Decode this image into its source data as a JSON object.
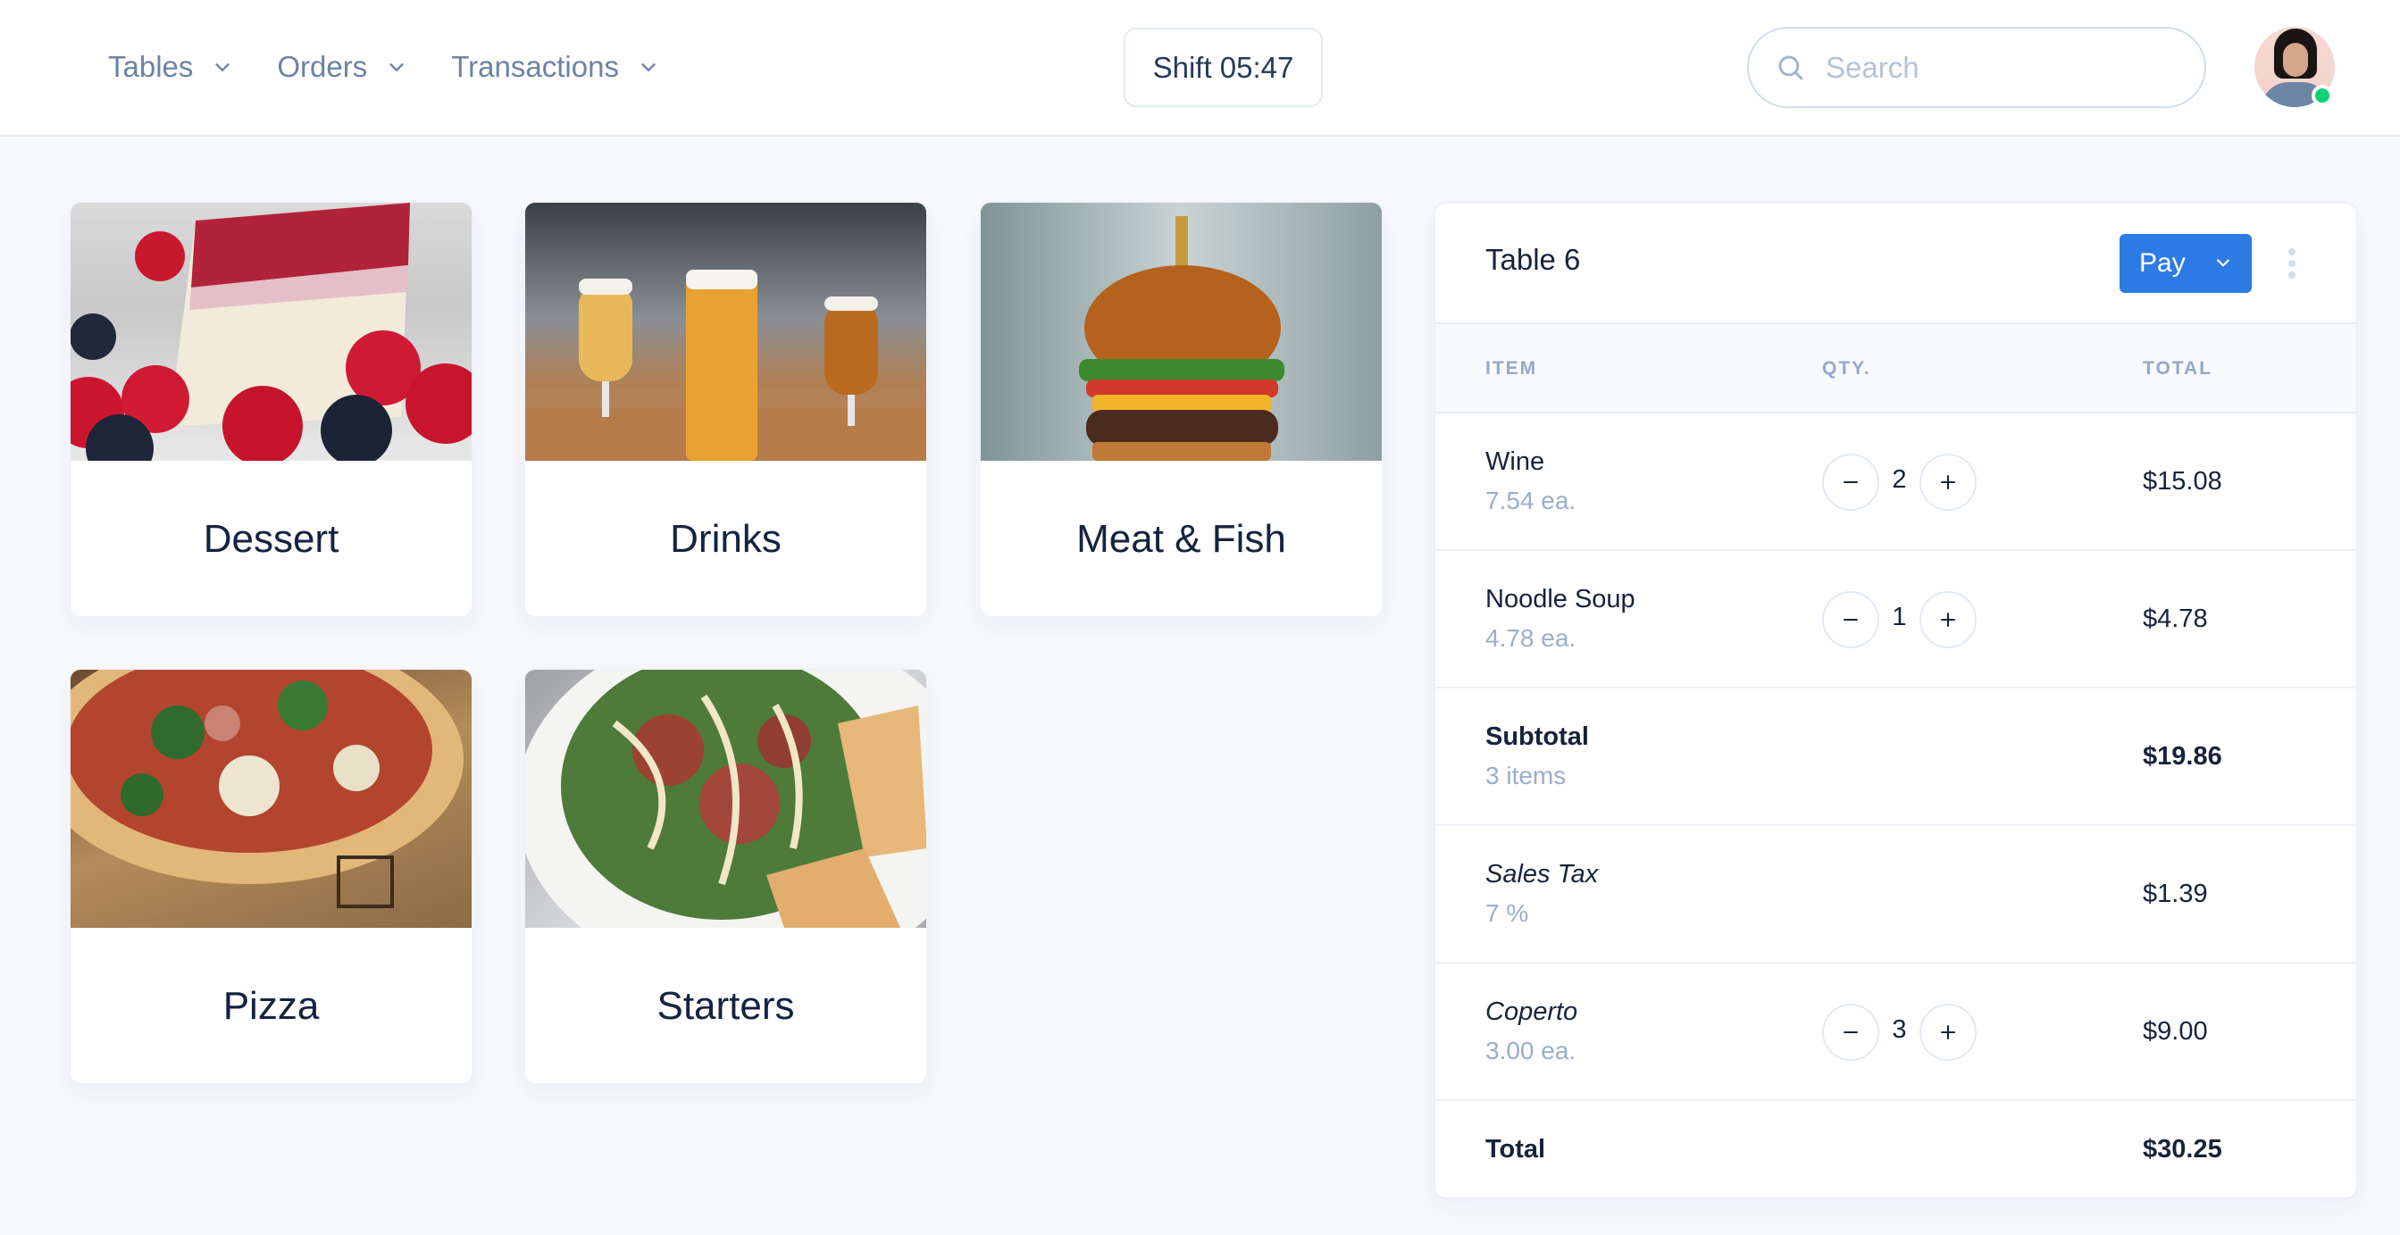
{
  "header": {
    "nav": [
      {
        "label": "Tables",
        "icon": "chevron-down-icon"
      },
      {
        "label": "Orders",
        "icon": "chevron-down-icon"
      },
      {
        "label": "Transactions",
        "icon": "chevron-down-icon"
      }
    ],
    "shift_label": "Shift 05:47",
    "search": {
      "placeholder": "Search",
      "value": "",
      "icon": "search-icon"
    },
    "avatar": {
      "status": "online",
      "status_color": "#10CF7A"
    }
  },
  "categories": [
    {
      "label": "Dessert"
    },
    {
      "label": "Drinks"
    },
    {
      "label": "Meat & Fish"
    },
    {
      "label": "Pizza"
    },
    {
      "label": "Starters"
    }
  ],
  "order": {
    "title": "Table 6",
    "pay_label": "Pay",
    "accent_color": "#2D7BE5",
    "columns": {
      "item": "ITEM",
      "qty": "QTY.",
      "total": "TOTAL"
    },
    "items": [
      {
        "name": "Wine",
        "sub": "7.54 ea.",
        "qty": "2",
        "total": "$15.08"
      },
      {
        "name": "Noodle Soup",
        "sub": "4.78 ea.",
        "qty": "1",
        "total": "$4.78"
      }
    ],
    "subtotal": {
      "label": "Subtotal",
      "sub": "3 items",
      "amount": "$19.86"
    },
    "tax": {
      "label": "Sales Tax",
      "sub": "7 %",
      "amount": "$1.39"
    },
    "coperto": {
      "label": "Coperto",
      "sub": "3.00 ea.",
      "qty": "3",
      "amount": "$9.00"
    },
    "total": {
      "label": "Total",
      "amount": "$30.25"
    }
  }
}
